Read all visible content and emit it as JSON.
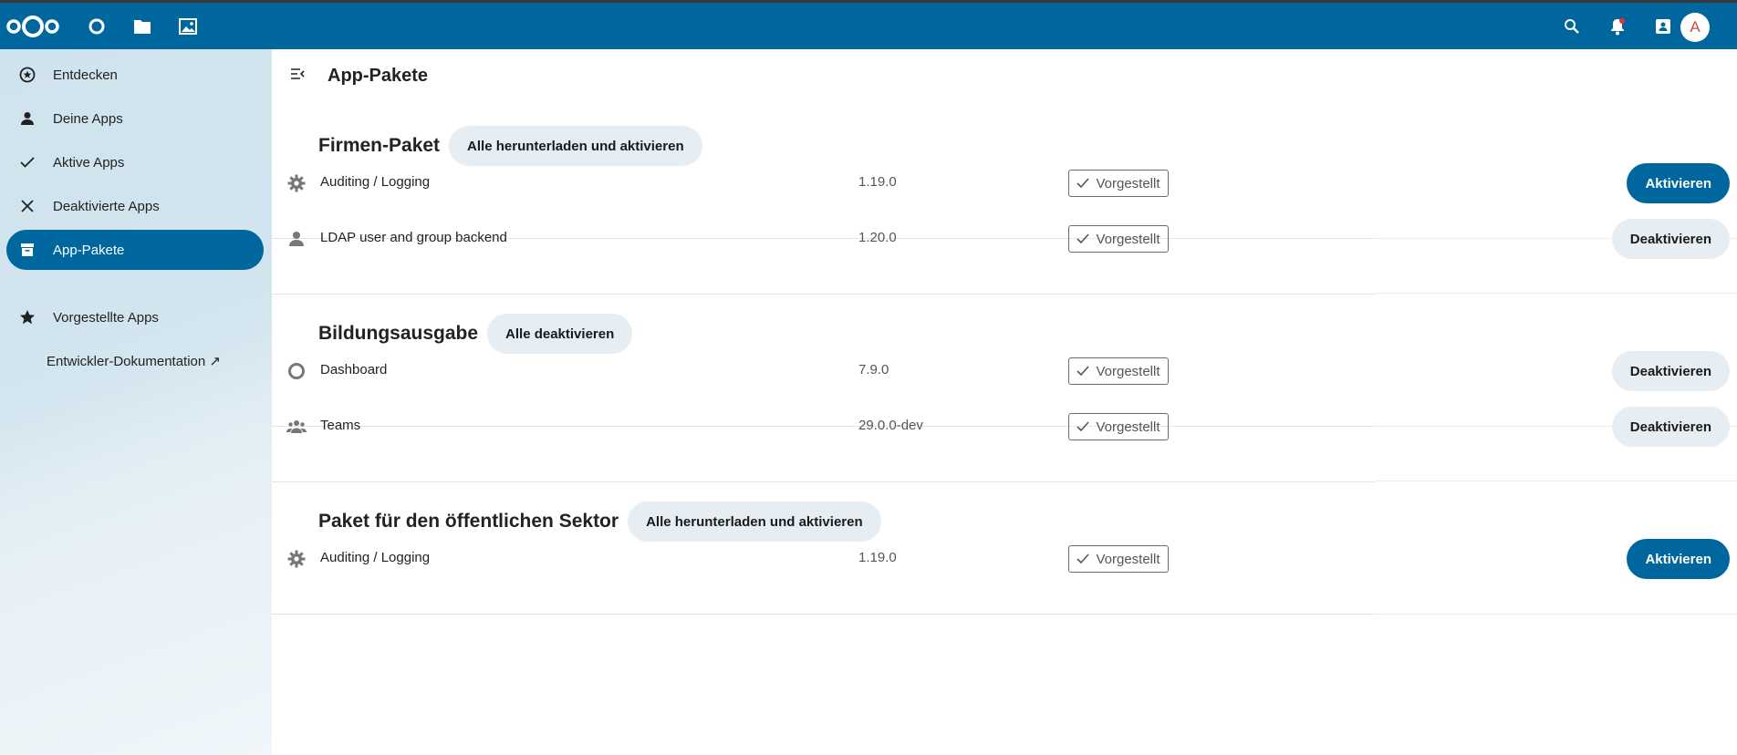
{
  "header": {
    "avatar_initial": "A",
    "brand_color": "#00679e",
    "icons": [
      "nextcloud-logo",
      "dashboard-icon",
      "files-icon",
      "photos-icon",
      "search-icon",
      "notifications-icon",
      "contacts-icon"
    ]
  },
  "sidebar": {
    "items": [
      {
        "label": "Entdecken",
        "icon": "discover-icon"
      },
      {
        "label": "Deine Apps",
        "icon": "user-icon"
      },
      {
        "label": "Aktive Apps",
        "icon": "check-icon"
      },
      {
        "label": "Deaktivierte Apps",
        "icon": "close-icon"
      },
      {
        "label": "App-Pakete",
        "icon": "archive-icon",
        "active": true
      },
      {
        "label": "Vorgestellte Apps",
        "icon": "star-icon"
      },
      {
        "label": "Entwickler-Dokumentation ↗"
      }
    ]
  },
  "main": {
    "title": "App-Pakete",
    "sections": [
      {
        "title": "Firmen-Paket",
        "button": "Alle herunterladen und aktivieren",
        "apps": [
          {
            "name": "Auditing / Logging",
            "version": "1.19.0",
            "badge": "Vorgestellt",
            "action": "Aktivieren",
            "icon": "gear-icon"
          },
          {
            "name": "LDAP user and group backend",
            "version": "1.20.0",
            "badge": "Vorgestellt",
            "action": "Deaktivieren",
            "icon": "user-icon"
          }
        ]
      },
      {
        "title": "Bildungsausgabe",
        "button": "Alle deaktivieren",
        "apps": [
          {
            "name": "Dashboard",
            "version": "7.9.0",
            "badge": "Vorgestellt",
            "action": "Deaktivieren",
            "icon": "dashboard-icon"
          },
          {
            "name": "Teams",
            "version": "29.0.0-dev",
            "badge": "Vorgestellt",
            "action": "Deaktivieren",
            "icon": "teams-icon"
          }
        ]
      },
      {
        "title": "Paket für den öffentlichen Sektor",
        "button": "Alle herunterladen und aktivieren",
        "apps": [
          {
            "name": "Auditing / Logging",
            "version": "1.19.0",
            "badge": "Vorgestellt",
            "action": "Aktivieren",
            "icon": "gear-icon"
          }
        ]
      }
    ]
  }
}
